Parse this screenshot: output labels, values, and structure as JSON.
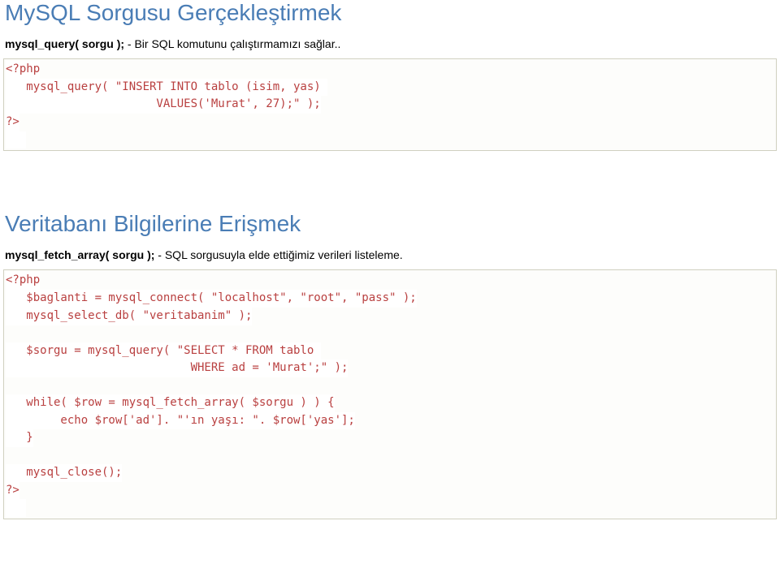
{
  "section1": {
    "heading": "MySQL Sorgusu Gerçekleştirmek",
    "desc_bold": "mysql_query( sorgu );",
    "desc_rest": " - Bir SQL komutunu çalıştırmamızı sağlar..",
    "code": {
      "l1": "<?php",
      "l2": "   mysql_query( \"INSERT INTO tablo (isim, yas) ",
      "l3": "                      VALUES('Murat', 27);\" );",
      "l4": "?>",
      "l5": "   "
    }
  },
  "section2": {
    "heading": "Veritabanı Bilgilerine Erişmek",
    "desc_bold": "mysql_fetch_array( sorgu );",
    "desc_rest": " - SQL sorgusuyla elde ettiğimiz verileri listeleme.",
    "code": {
      "l1": "<?php",
      "l2": "   $baglanti = mysql_connect( \"localhost\", \"root\", \"pass\" );",
      "l3": "   mysql_select_db( \"veritabanim\" );",
      "l4": "   $sorgu = mysql_query( \"SELECT * FROM tablo ",
      "l5": "                           WHERE ad = 'Murat';\" );",
      "l6": "   while( $row = mysql_fetch_array( $sorgu ) ) {",
      "l7": "        echo $row['ad']. \"'ın yaşı: \". $row['yas'];",
      "l8": "   }",
      "l9": "   mysql_close();",
      "l10": "?>",
      "l11": "   "
    }
  }
}
